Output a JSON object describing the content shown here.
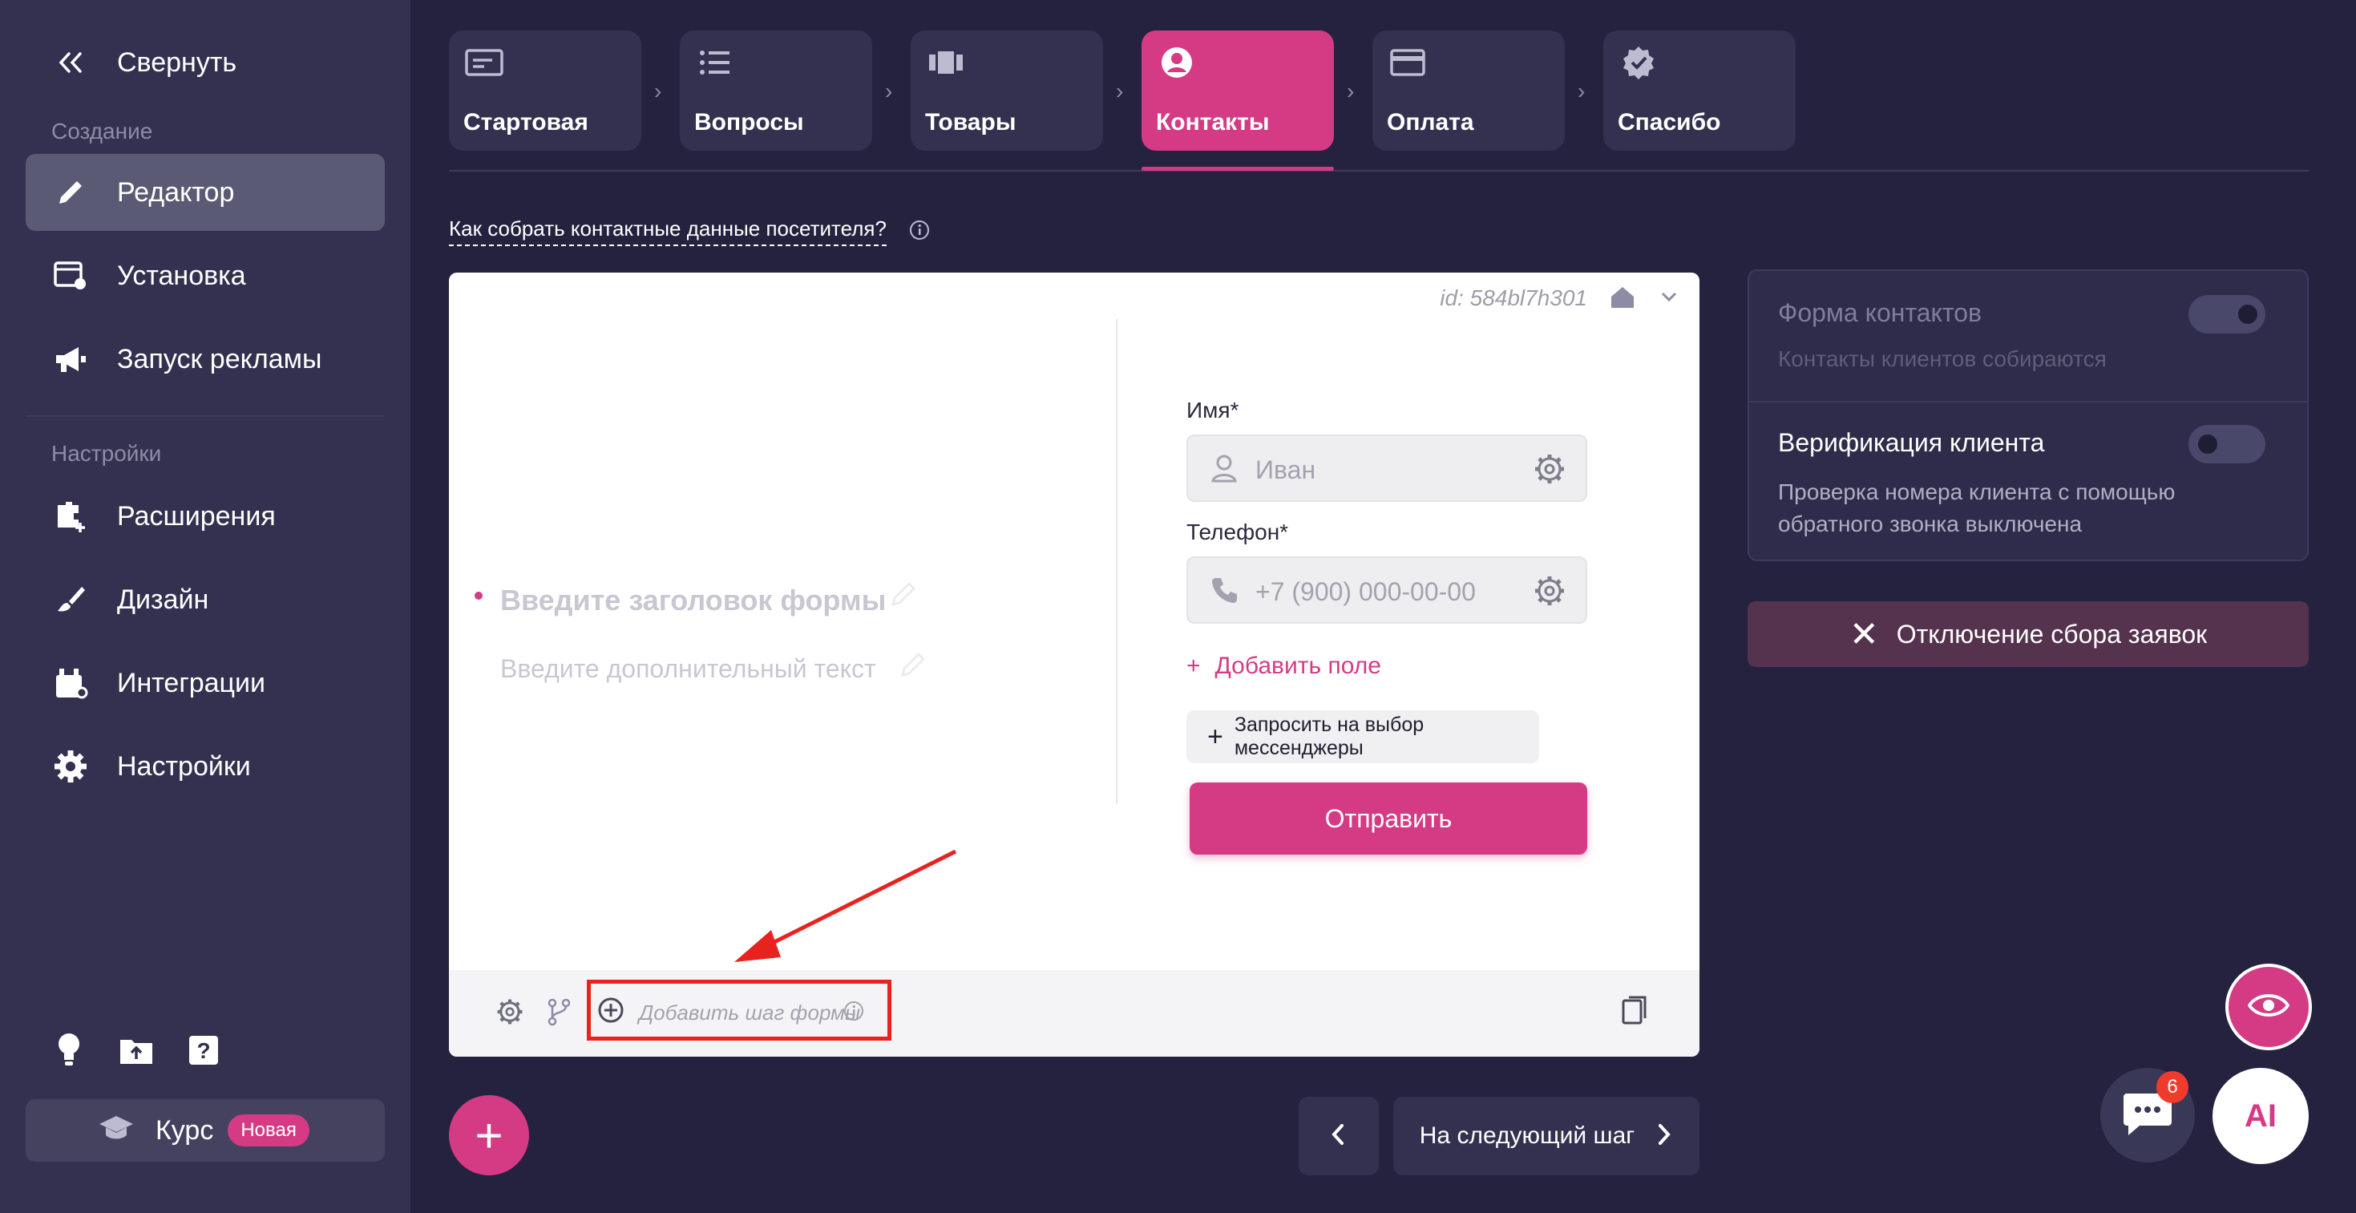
{
  "sidebar": {
    "collapse_label": "Свернуть",
    "section_create": "Создание",
    "items_create": [
      {
        "label": "Редактор"
      },
      {
        "label": "Установка"
      },
      {
        "label": "Запуск рекламы"
      }
    ],
    "section_settings": "Настройки",
    "items_settings": [
      {
        "label": "Расширения"
      },
      {
        "label": "Дизайн"
      },
      {
        "label": "Интеграции"
      },
      {
        "label": "Настройки"
      }
    ],
    "course_label": "Курс",
    "course_badge": "Новая"
  },
  "steps": [
    {
      "label": "Стартовая"
    },
    {
      "label": "Вопросы"
    },
    {
      "label": "Товары"
    },
    {
      "label": "Контакты"
    },
    {
      "label": "Оплата"
    },
    {
      "label": "Спасибо"
    }
  ],
  "help_link": "Как собрать контактные данные посетителя?",
  "form": {
    "id_text": "id: 584bl7h301",
    "title_placeholder": "Введите заголовок формы",
    "subtitle_placeholder": "Введите дополнительный текст",
    "fields": [
      {
        "label": "Имя*",
        "placeholder": "Иван"
      },
      {
        "label": "Телефон*",
        "placeholder": "+7 (900) 000-00-00"
      }
    ],
    "add_field": "Добавить поле",
    "messenger_label": "Запросить на выбор мессенджеры",
    "submit_label": "Отправить",
    "add_step_label": "Добавить шаг формы"
  },
  "right_panel": {
    "contacts_title": "Форма контактов",
    "contacts_sub": "Контакты клиентов собираются",
    "verify_title": "Верификация клиента",
    "verify_sub": "Проверка номера клиента с помощью обратного звонка выключена",
    "disable_label": "Отключение сбора заявок"
  },
  "bottom": {
    "next_label": "На следующий шаг",
    "chat_badge": "6",
    "ai_label": "AI"
  },
  "colors": {
    "accent": "#d43b84",
    "background": "#24223f",
    "sidebar": "#33314f",
    "annotation_red": "#e8221f"
  }
}
